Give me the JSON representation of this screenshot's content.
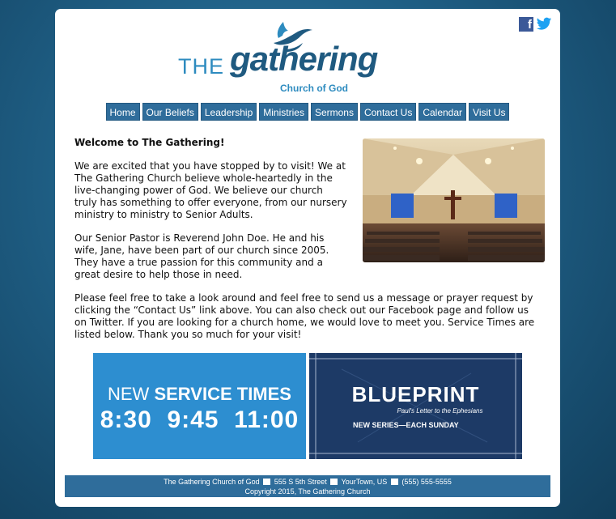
{
  "social": {
    "facebook_icon": "facebook-icon",
    "twitter_icon": "twitter-icon",
    "facebook_glyph": "f"
  },
  "logo": {
    "the": "THE",
    "gathering": "gathering",
    "sub": "Church of God"
  },
  "nav": [
    "Home",
    "Our Beliefs",
    "Leadership",
    "Ministries",
    "Sermons",
    "Contact Us",
    "Calendar",
    "Visit Us"
  ],
  "content": {
    "welcome": "Welcome to The Gathering!",
    "p1": "We are excited that you have stopped by to visit! We at The Gathering Church believe whole-heartedly in the live-changing power of God. We believe our church truly has something to offer everyone, from our nursery ministry to ministry to Senior Adults.",
    "p2": "Our Senior Pastor is Reverend John Doe. He and his wife, Jane, have been part of our church since 2005. They have a true passion for this community and a great desire to help those in need.",
    "p3": "Please feel free to take a look around and feel free to send us a message or prayer request by clicking the “Contact Us” link above. You can also check out our Facebook page and follow us on Twitter. If you are looking for a church home, we would love to meet you. Service Times are listed below. Thank you so much for your visit!"
  },
  "banner_service": {
    "new": "NEW",
    "service_times": "SERVICE TIMES",
    "times": "8:30  9:45  11:00"
  },
  "banner_blueprint": {
    "title": "BLUEPRINT",
    "subtitle": "Paul's Letter to the Ephesians",
    "series": "NEW SERIES—EACH SUNDAY"
  },
  "footer": {
    "name": "The Gathering Church of God",
    "address": "555 S 5th Street",
    "town": "YourTown, US",
    "phone": "(555) 555-5555",
    "copyright": "Copyright 2015, The Gathering Church"
  },
  "colors": {
    "nav": "#2f6d9b",
    "accent": "#2d8bbf",
    "brand_dark": "#1f5a80",
    "background": "#1f5f85"
  }
}
